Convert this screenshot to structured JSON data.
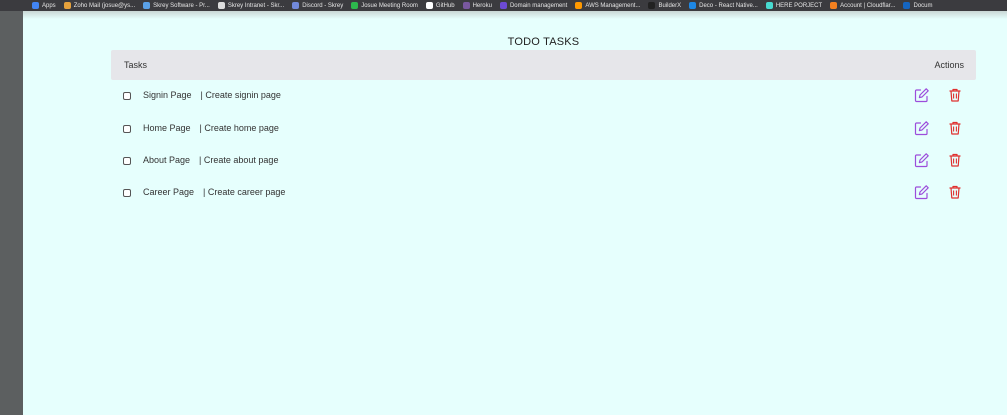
{
  "bookmarks": [
    {
      "label": "Apps",
      "color": "#4285f4"
    },
    {
      "label": "Zoho Mail (josue@ys...",
      "color": "#e6a23c"
    },
    {
      "label": "Skrey Software - Pr...",
      "color": "#5aa0e6"
    },
    {
      "label": "Skrey Intranet - Skr...",
      "color": "#dddddd"
    },
    {
      "label": "Discord - Skrey",
      "color": "#7289da"
    },
    {
      "label": "Josue Meeting Room",
      "color": "#2db84d"
    },
    {
      "label": "GitHub",
      "color": "#ffffff"
    },
    {
      "label": "Heroku",
      "color": "#79589f"
    },
    {
      "label": "Domain management",
      "color": "#6c4ad6"
    },
    {
      "label": "AWS Management...",
      "color": "#ff9900"
    },
    {
      "label": "BuilderX",
      "color": "#222222"
    },
    {
      "label": "Deco - React Native...",
      "color": "#1e88e5"
    },
    {
      "label": "HERE PORJECT",
      "color": "#48dad0"
    },
    {
      "label": "Account | Cloudflar...",
      "color": "#f48120"
    },
    {
      "label": "Docum",
      "color": "#1565c0"
    }
  ],
  "page": {
    "title": "TODO TASKS"
  },
  "table": {
    "header_tasks": "Tasks",
    "header_actions": "Actions"
  },
  "tasks": [
    {
      "name": "Signin Page",
      "description": "| Create signin page"
    },
    {
      "name": "Home Page",
      "description": "| Create home page"
    },
    {
      "name": "About Page",
      "description": "| Create about page"
    },
    {
      "name": "Career Page",
      "description": "| Create career page"
    }
  ],
  "colors": {
    "background": "#e6fffd",
    "edit_icon": "#9c4ddb",
    "delete_icon": "#e0302f"
  },
  "icons": {
    "edit": "edit-icon",
    "delete": "trash-icon"
  }
}
